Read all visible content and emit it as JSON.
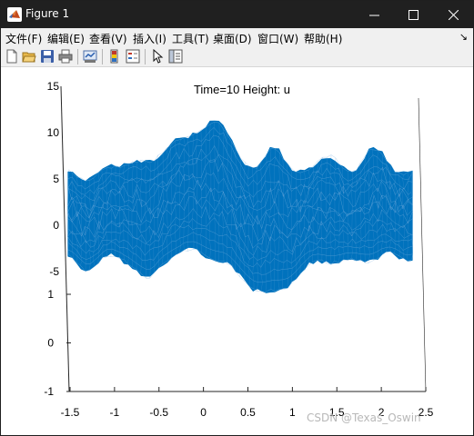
{
  "window": {
    "title": "Figure 1",
    "icon": "matlab-logo-icon"
  },
  "controls": {
    "minimize": "minimize-icon",
    "maximize": "maximize-icon",
    "close": "close-icon"
  },
  "menu": {
    "items": [
      "文件(F)",
      "编辑(E)",
      "查看(V)",
      "插入(I)",
      "工具(T)",
      "桌面(D)",
      "窗口(W)",
      "帮助(H)"
    ],
    "overflow_arrow": "↘"
  },
  "toolbar": {
    "icons": [
      "new-figure-icon",
      "open-file-icon",
      "save-icon",
      "print-icon",
      "link-plot-icon",
      "colorbar-icon",
      "legend-icon",
      "pointer-icon",
      "property-editor-icon"
    ]
  },
  "chart_data": {
    "type": "surface-mesh",
    "title": "Time=10   Height: u",
    "mesh_color": "#0072BD",
    "x_ticks": [
      "-1.5",
      "-1",
      "-0.5",
      "0",
      "0.5",
      "1",
      "1.5",
      "2",
      "2.5"
    ],
    "y_ticks": [
      "-1",
      "0",
      "1"
    ],
    "z_ticks": [
      "-5",
      "0",
      "5",
      "10",
      "15"
    ],
    "xlim": [
      -1.5,
      2.5
    ],
    "ylim": [
      -1,
      1
    ],
    "zlim": [
      -5,
      15
    ],
    "grid": false
  },
  "watermark": "CSDN @Texas_Oswin"
}
